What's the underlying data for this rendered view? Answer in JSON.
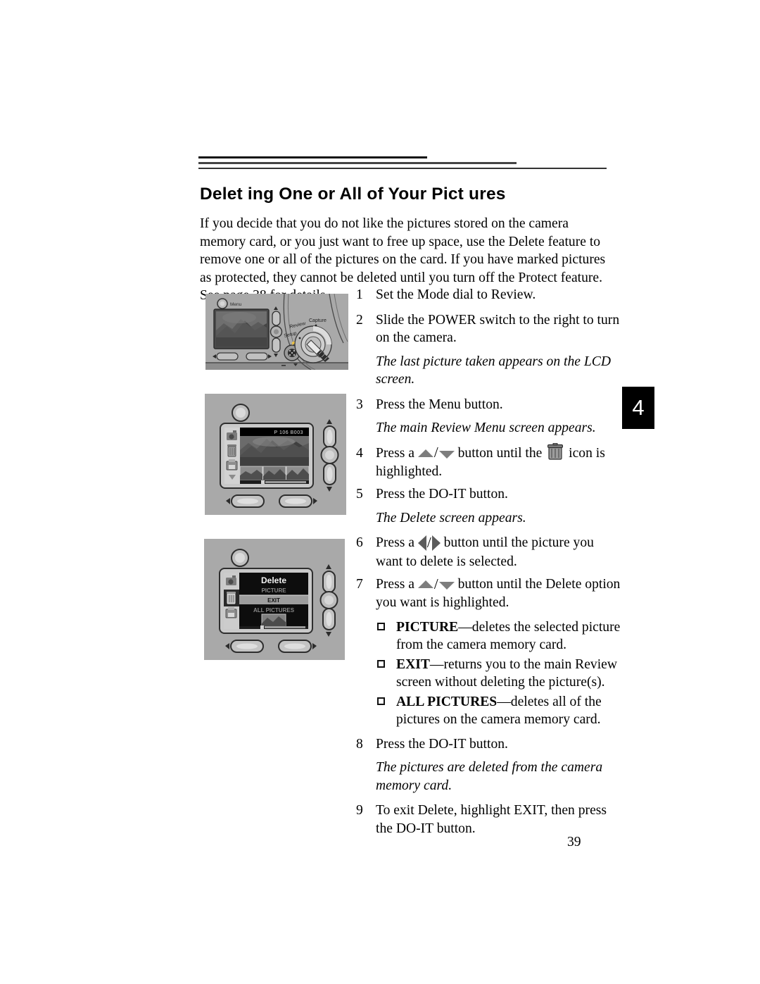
{
  "document": {
    "page_number": "39",
    "chapter_tab": "4",
    "title": "Delet ing One or All of Your Pict ures",
    "intro": "If you decide that you do not like the pictures stored on the camera memory card, or you just want to free up space, use the Delete feature to remove one or all of the pictures on the card. If you have marked pictures as protected, they cannot be deleted until you turn off the Protect feature. See page 38 for details."
  },
  "steps": {
    "s1": {
      "num": "1",
      "text": "Set the Mode dial to Review."
    },
    "s2": {
      "num": "2",
      "text": "Slide the POWER switch to the right to turn on the camera."
    },
    "n2": "The last picture taken appears on the LCD screen.",
    "s3": {
      "num": "3",
      "text": "Press the Menu button."
    },
    "n3": "The main Review Menu screen appears.",
    "s4": {
      "num": "4",
      "prefix": "Press a",
      "middle": "button until the",
      "suffix": "icon is highlighted."
    },
    "s5": {
      "num": "5",
      "text": "Press the DO-IT button."
    },
    "n5": "The Delete screen appears.",
    "s6": {
      "num": "6",
      "prefix": "Press a",
      "suffix": "button until the picture you want to delete is selected."
    },
    "s7": {
      "num": "7",
      "prefix": "Press a",
      "suffix": "button until the Delete option you want is highlighted."
    },
    "s8": {
      "num": "8",
      "text": "Press the DO-IT button."
    },
    "n8": "The pictures are deleted from the camera memory card.",
    "s9": {
      "num": "9",
      "text": "To exit Delete, highlight EXIT, then press the DO-IT button."
    }
  },
  "options": [
    {
      "name": "PICTURE",
      "desc": "—deletes the selected picture from the camera memory card."
    },
    {
      "name": "EXIT",
      "desc": "—returns you to the main Review screen without deleting the picture(s)."
    },
    {
      "name": "ALL PICTURES",
      "desc": "—deletes all of the pictures on the camera memory card."
    }
  ],
  "figures": {
    "fig1": {
      "caption_labels": {
        "menu": "Menu",
        "dial_capture": "Capture",
        "dial_review": "Review",
        "dial_setup": "Setup"
      }
    },
    "fig2": {
      "lcd_status": "P 106  B003"
    },
    "fig3": {
      "screen_title": "Delete",
      "menu_items": [
        "PICTURE",
        "EXIT",
        "ALL PICTURES"
      ],
      "highlighted": "EXIT"
    }
  },
  "colors": {
    "camera_body": "#a9a9a9",
    "lcd_dark": "#121212",
    "arrow_gray": "#7d7d7d",
    "tab_black": "#000000"
  }
}
